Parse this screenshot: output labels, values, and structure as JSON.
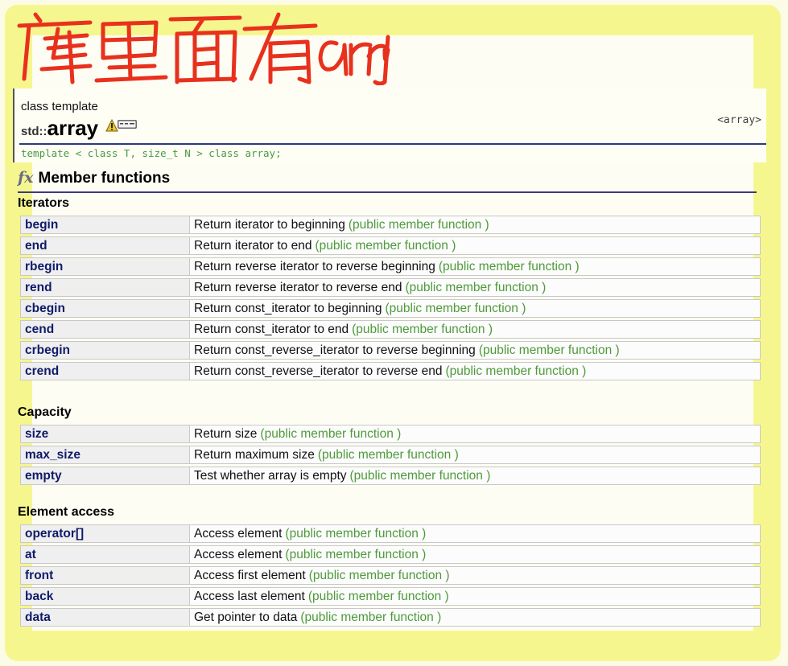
{
  "annotation": {
    "text": "库里面有arry"
  },
  "header": {
    "kind": "class template",
    "namespace": "std",
    "separator": "::",
    "name": "array",
    "link": "<array>",
    "declaration": "template < class T, size_t N > class array;"
  },
  "member_functions": {
    "title": "Member functions",
    "groups": [
      {
        "title": "Iterators",
        "rows": [
          {
            "name": "begin",
            "desc": "Return iterator to beginning",
            "kind": "(public member function )"
          },
          {
            "name": "end",
            "desc": "Return iterator to end",
            "kind": "(public member function )"
          },
          {
            "name": "rbegin",
            "desc": "Return reverse iterator to reverse beginning",
            "kind": "(public member function )"
          },
          {
            "name": "rend",
            "desc": "Return reverse iterator to reverse end",
            "kind": "(public member function )"
          },
          {
            "name": "cbegin",
            "desc": "Return const_iterator to beginning",
            "kind": "(public member function )"
          },
          {
            "name": "cend",
            "desc": "Return const_iterator to end",
            "kind": "(public member function )"
          },
          {
            "name": "crbegin",
            "desc": "Return const_reverse_iterator to reverse beginning",
            "kind": "(public member function )"
          },
          {
            "name": "crend",
            "desc": "Return const_reverse_iterator to reverse end",
            "kind": "(public member function )"
          }
        ]
      },
      {
        "title": "Capacity",
        "rows": [
          {
            "name": "size",
            "desc": "Return size",
            "kind": "(public member function )"
          },
          {
            "name": "max_size",
            "desc": "Return maximum size",
            "kind": "(public member function )"
          },
          {
            "name": "empty",
            "desc": "Test whether array is empty",
            "kind": "(public member function )"
          }
        ]
      },
      {
        "title": "Element access",
        "rows": [
          {
            "name": "operator[]",
            "desc": "Access element",
            "kind": "(public member function )"
          },
          {
            "name": "at",
            "desc": "Access element",
            "kind": "(public member function )"
          },
          {
            "name": "front",
            "desc": "Access first element",
            "kind": "(public member function )"
          },
          {
            "name": "back",
            "desc": "Access last element",
            "kind": "(public member function )"
          },
          {
            "name": "data",
            "desc": "Get pointer to data",
            "kind": "(public member function )"
          }
        ]
      }
    ]
  },
  "colors": {
    "highlighter": "#f6f58a",
    "handwriting": "#e8311d",
    "member_name": "#0f1b6a",
    "kind_text": "#4e9a3a"
  },
  "icons": {
    "cpp11_warning": "warning-icon"
  }
}
